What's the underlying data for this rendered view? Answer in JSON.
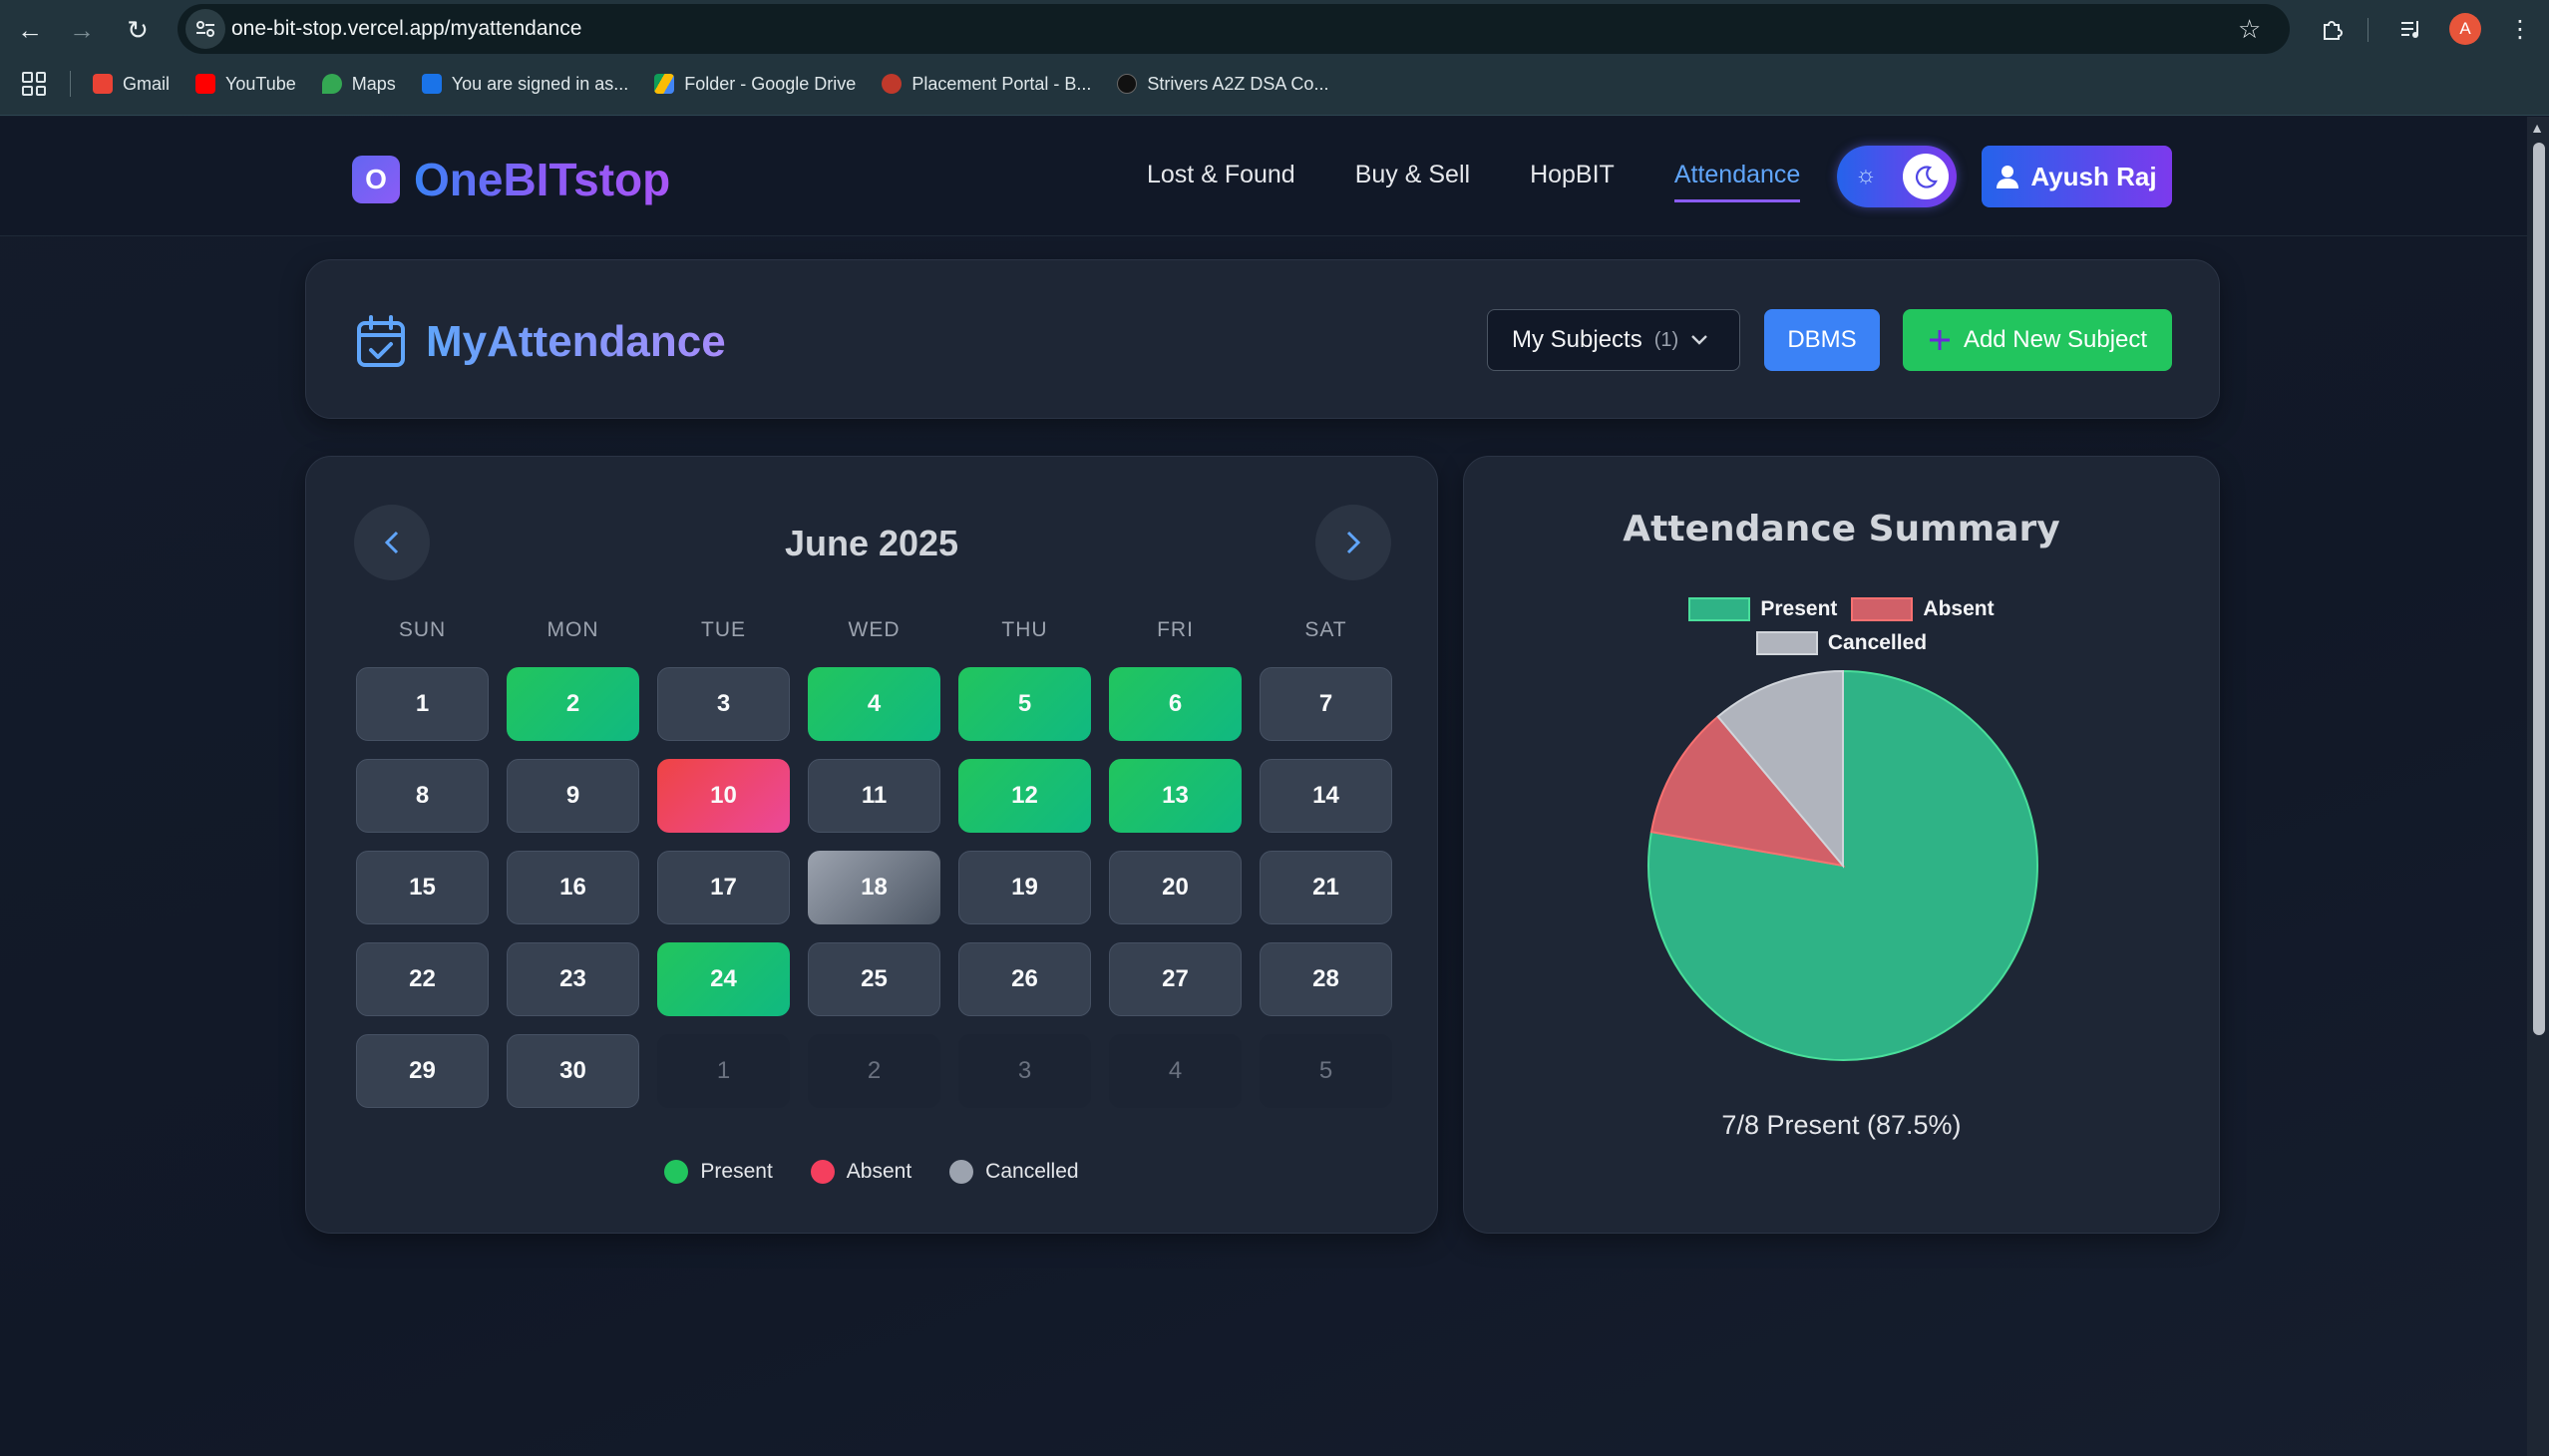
{
  "browser": {
    "url": "one-bit-stop.vercel.app/myattendance",
    "profile_initial": "A",
    "bookmarks": [
      {
        "label": "Gmail",
        "color": "#ea4335"
      },
      {
        "label": "YouTube",
        "color": "#ff0000"
      },
      {
        "label": "Maps",
        "color": "#34a853"
      },
      {
        "label": "You are signed in as...",
        "color": "#1a73e8"
      },
      {
        "label": "Folder - Google Drive",
        "color": "#fbbc04"
      },
      {
        "label": "Placement Portal - B...",
        "color": "#c0392b"
      },
      {
        "label": "Strivers A2Z DSA Co...",
        "color": "#111111"
      }
    ]
  },
  "header": {
    "logo_letter": "O",
    "logo_text": "OneBITstop",
    "nav": [
      "Lost & Found",
      "Buy & Sell",
      "HopBIT",
      "Attendance"
    ],
    "active_nav": "Attendance",
    "user_name": "Ayush Raj"
  },
  "toolbar": {
    "title": "MyAttendance",
    "subjects_label": "My Subjects",
    "subjects_count": "(1)",
    "selected_subject": "DBMS",
    "add_subject_label": "Add New Subject"
  },
  "calendar": {
    "month_label": "June 2025",
    "weekdays": [
      "SUN",
      "MON",
      "TUE",
      "WED",
      "THU",
      "FRI",
      "SAT"
    ],
    "days": [
      {
        "label": "1",
        "status": "normal"
      },
      {
        "label": "2",
        "status": "present"
      },
      {
        "label": "3",
        "status": "normal"
      },
      {
        "label": "4",
        "status": "present"
      },
      {
        "label": "5",
        "status": "present"
      },
      {
        "label": "6",
        "status": "present"
      },
      {
        "label": "7",
        "status": "normal"
      },
      {
        "label": "8",
        "status": "normal"
      },
      {
        "label": "9",
        "status": "normal"
      },
      {
        "label": "10",
        "status": "absent"
      },
      {
        "label": "11",
        "status": "normal"
      },
      {
        "label": "12",
        "status": "present"
      },
      {
        "label": "13",
        "status": "present"
      },
      {
        "label": "14",
        "status": "normal"
      },
      {
        "label": "15",
        "status": "normal"
      },
      {
        "label": "16",
        "status": "normal"
      },
      {
        "label": "17",
        "status": "normal"
      },
      {
        "label": "18",
        "status": "cancelled"
      },
      {
        "label": "19",
        "status": "normal"
      },
      {
        "label": "20",
        "status": "normal"
      },
      {
        "label": "21",
        "status": "normal"
      },
      {
        "label": "22",
        "status": "normal"
      },
      {
        "label": "23",
        "status": "normal"
      },
      {
        "label": "24",
        "status": "present"
      },
      {
        "label": "25",
        "status": "normal"
      },
      {
        "label": "26",
        "status": "normal"
      },
      {
        "label": "27",
        "status": "normal"
      },
      {
        "label": "28",
        "status": "normal"
      },
      {
        "label": "29",
        "status": "normal"
      },
      {
        "label": "30",
        "status": "normal"
      },
      {
        "label": "1",
        "status": "outside"
      },
      {
        "label": "2",
        "status": "outside"
      },
      {
        "label": "3",
        "status": "outside"
      },
      {
        "label": "4",
        "status": "outside"
      },
      {
        "label": "5",
        "status": "outside"
      }
    ],
    "legend": [
      {
        "label": "Present",
        "color": "#22c55e"
      },
      {
        "label": "Absent",
        "color": "#f43f5e"
      },
      {
        "label": "Cancelled",
        "color": "#9ca3af"
      }
    ]
  },
  "summary": {
    "title": "Attendance Summary",
    "caption": "7/8 Present (87.5%)"
  },
  "chart_data": {
    "type": "pie",
    "labels": [
      "Present",
      "Absent",
      "Cancelled"
    ],
    "values": [
      7,
      1,
      1
    ],
    "colors": [
      "#2fb386",
      "#d16068",
      "#b0b4bd"
    ],
    "border_colors": [
      "#4ade9b",
      "#f87171",
      "#d1d5db"
    ],
    "legend_position": "top"
  }
}
